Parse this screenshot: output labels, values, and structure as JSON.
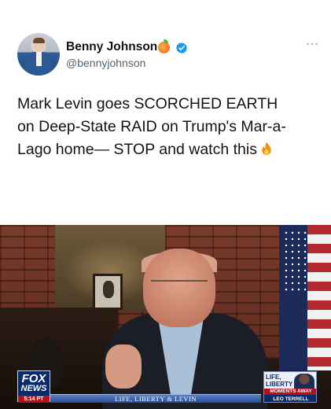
{
  "tweet": {
    "author": {
      "display_name": "Benny Johnson",
      "handle": "@bennyjohnson",
      "badges": [
        "peach-emoji",
        "verified-badge"
      ]
    },
    "text_lines": [
      "Mark Levin goes SCORCHED EARTH",
      "on Deep-State RAID on Trump's Mar-a-",
      "Lago home— STOP and watch this"
    ],
    "trailing_emoji": "fire"
  },
  "video": {
    "network_logo": {
      "line1": "FOX",
      "line2": "NEWS",
      "time": "5:14 PT"
    },
    "lower_third": "LIFE, LIBERTY & LEVIN",
    "promo": {
      "show": "LIFE, LIBERTY & LEVIN",
      "badge": "MOMENTS AWAY",
      "guest": "LEO TERRELL"
    }
  },
  "colors": {
    "verified": "#1d9bf0",
    "fox_blue": "#0b2a6b",
    "fox_red": "#b3121a",
    "text_primary": "#0f1419",
    "text_secondary": "#536471"
  }
}
